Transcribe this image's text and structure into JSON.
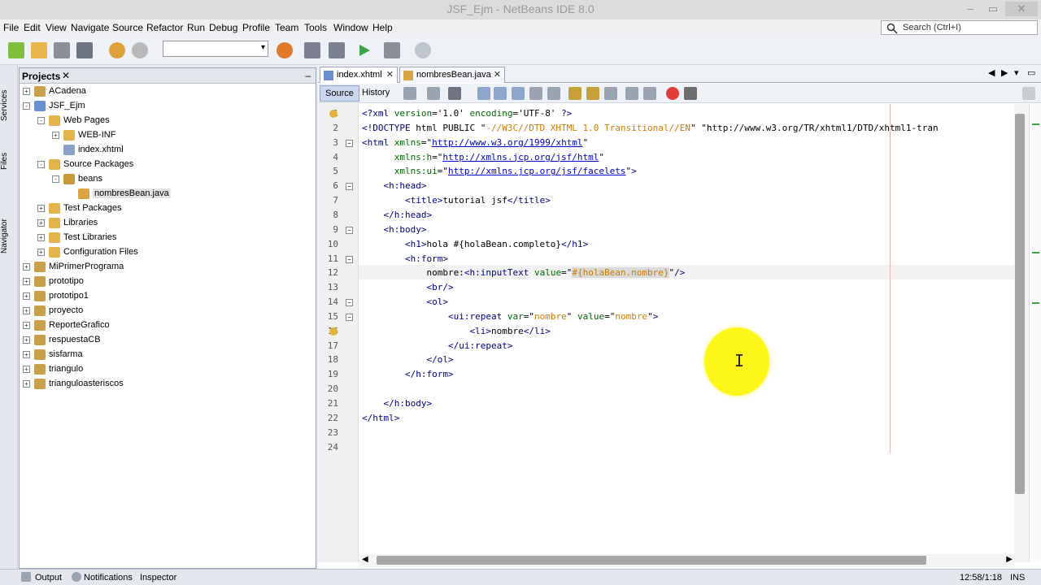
{
  "window": {
    "title": "JSF_Ejm - NetBeans IDE 8.0"
  },
  "menu": [
    "File",
    "Edit",
    "View",
    "Navigate",
    "Source",
    "Refactor",
    "Run",
    "Debug",
    "Profile",
    "Team",
    "Tools",
    "Window",
    "Help"
  ],
  "search": {
    "placeholder": "Search (Ctrl+I)"
  },
  "side_tabs": [
    "Services",
    "Files",
    "Navigator"
  ],
  "projects": {
    "title": "Projects",
    "tree": [
      {
        "label": "ACadena",
        "depth": 0,
        "kind": "project",
        "expander": "+"
      },
      {
        "label": "JSF_Ejm",
        "depth": 0,
        "kind": "web",
        "expander": "-"
      },
      {
        "label": "Web Pages",
        "depth": 1,
        "kind": "folder",
        "expander": "-"
      },
      {
        "label": "WEB-INF",
        "depth": 2,
        "kind": "folder",
        "expander": "+"
      },
      {
        "label": "index.xhtml",
        "depth": 2,
        "kind": "file",
        "expander": ""
      },
      {
        "label": "Source Packages",
        "depth": 1,
        "kind": "folder",
        "expander": "-"
      },
      {
        "label": "beans",
        "depth": 2,
        "kind": "package",
        "expander": "-"
      },
      {
        "label": "nombresBean.java",
        "depth": 3,
        "kind": "java",
        "expander": "",
        "selected": true
      },
      {
        "label": "Test Packages",
        "depth": 1,
        "kind": "folder",
        "expander": "+"
      },
      {
        "label": "Libraries",
        "depth": 1,
        "kind": "folder",
        "expander": "+"
      },
      {
        "label": "Test Libraries",
        "depth": 1,
        "kind": "folder",
        "expander": "+"
      },
      {
        "label": "Configuration Files",
        "depth": 1,
        "kind": "folder",
        "expander": "+"
      },
      {
        "label": "MiPrimerPrograma",
        "depth": 0,
        "kind": "project",
        "expander": "+"
      },
      {
        "label": "prototipo",
        "depth": 0,
        "kind": "project",
        "expander": "+"
      },
      {
        "label": "prototipo1",
        "depth": 0,
        "kind": "project",
        "expander": "+"
      },
      {
        "label": "proyecto",
        "depth": 0,
        "kind": "project",
        "expander": "+"
      },
      {
        "label": "ReporteGrafico",
        "depth": 0,
        "kind": "project",
        "expander": "+"
      },
      {
        "label": "respuestaCB",
        "depth": 0,
        "kind": "project",
        "expander": "+"
      },
      {
        "label": "sisfarma",
        "depth": 0,
        "kind": "project",
        "expander": "+"
      },
      {
        "label": "triangulo",
        "depth": 0,
        "kind": "project",
        "expander": "+"
      },
      {
        "label": "trianguloasteriscos",
        "depth": 0,
        "kind": "project",
        "expander": "+"
      }
    ]
  },
  "editor": {
    "tabs": [
      {
        "label": "index.xhtml",
        "active": true
      },
      {
        "label": "nombresBean.java",
        "active": false
      }
    ],
    "views": {
      "source": "Source",
      "history": "History"
    },
    "lines": [
      {
        "n": 1,
        "text": "<?xml version='1.0' encoding='UTF-8' ?>"
      },
      {
        "n": 2,
        "text": "<!DOCTYPE html PUBLIC \"-//W3C//DTD XHTML 1.0 Transitional//EN\" \"http://www.w3.org/TR/xhtml1/DTD/xhtml1-tran"
      },
      {
        "n": 3,
        "text": "<html xmlns=\"http://www.w3.org/1999/xhtml\""
      },
      {
        "n": 4,
        "text": "      xmlns:h=\"http://xmlns.jcp.org/jsf/html\""
      },
      {
        "n": 5,
        "text": "      xmlns:ui=\"http://xmlns.jcp.org/jsf/facelets\">"
      },
      {
        "n": 6,
        "text": "    <h:head>"
      },
      {
        "n": 7,
        "text": "        <title>tutorial jsf</title>"
      },
      {
        "n": 8,
        "text": "    </h:head>"
      },
      {
        "n": 9,
        "text": "    <h:body>"
      },
      {
        "n": 10,
        "text": "        <h1>hola #{holaBean.completo}</h1>"
      },
      {
        "n": 11,
        "text": "        <h:form>"
      },
      {
        "n": 12,
        "text": "            nombre:<h:inputText value=\"#{holaBean.nombre}\"/>"
      },
      {
        "n": 13,
        "text": "            <br/>"
      },
      {
        "n": 14,
        "text": "            <ol>"
      },
      {
        "n": 15,
        "text": "                <ui:repeat var=\"nombre\" value=\"nombre\">"
      },
      {
        "n": 16,
        "text": "                    <li>nombre</li>"
      },
      {
        "n": 17,
        "text": "                </ui:repeat>"
      },
      {
        "n": 18,
        "text": "            </ol>"
      },
      {
        "n": 19,
        "text": "        </h:form>"
      },
      {
        "n": 20,
        "text": ""
      },
      {
        "n": 21,
        "text": "    </h:body>"
      },
      {
        "n": 22,
        "text": "</html>"
      },
      {
        "n": 23,
        "text": ""
      },
      {
        "n": 24,
        "text": ""
      }
    ]
  },
  "status": {
    "output": "Output",
    "notifications": "Notifications",
    "inspector": "Inspector",
    "position": "12:58/1:18",
    "mode": "INS"
  }
}
